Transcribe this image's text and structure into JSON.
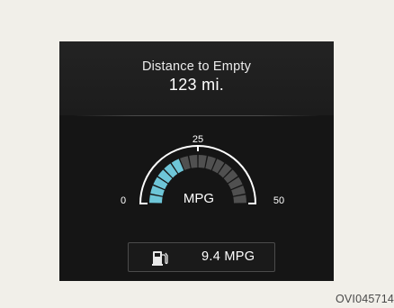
{
  "distance_to_empty": {
    "title": "Distance to Empty",
    "value": "123 mi."
  },
  "mpg_gauge": {
    "label": "MPG",
    "min_label": "0",
    "mid_label": "25",
    "max_label": "50",
    "min": 0,
    "max": 50,
    "current_value": 9.4,
    "total_segments": 16,
    "lit_segments": 6,
    "colors": {
      "lit_segment": "#6ec6d8",
      "unlit_segment": "#505050",
      "scale_arc": "#ffffff"
    }
  },
  "fuel_economy": {
    "icon": "fuel-pump-icon",
    "value": "9.4 MPG"
  },
  "figure_code": "OVI045714"
}
